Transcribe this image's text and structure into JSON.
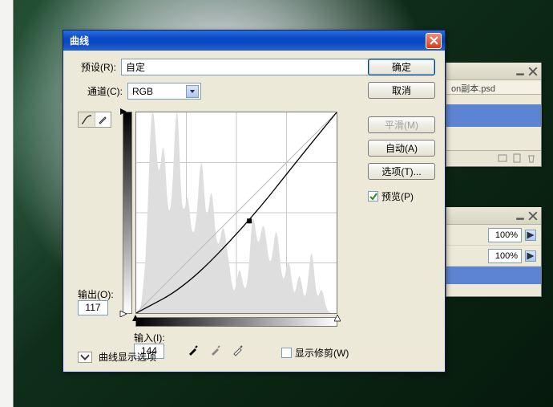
{
  "dialog": {
    "title": "曲线",
    "preset_label": "预设(R):",
    "preset_value": "自定",
    "channel_label": "通道(C):",
    "channel_value": "RGB",
    "output_label": "输出(O):",
    "output_value": "117",
    "input_label": "输入(I):",
    "input_value": "144",
    "show_clipping_label": "显示修剪(W)",
    "expand_label": "曲线显示选项"
  },
  "buttons": {
    "ok": "确定",
    "cancel": "取消",
    "smooth": "平滑(M)",
    "auto": "自动(A)",
    "options": "选项(T)...",
    "preview": "预览(P)"
  },
  "panels": {
    "doc_tab": "on副本.psd",
    "opacity1": "100%",
    "opacity2": "100%"
  },
  "chart_data": {
    "type": "line",
    "title": "",
    "xlabel": "输入",
    "ylabel": "输出",
    "xlim": [
      0,
      255
    ],
    "ylim": [
      0,
      255
    ],
    "series": [
      {
        "name": "baseline",
        "x": [
          0,
          255
        ],
        "y": [
          0,
          255
        ]
      },
      {
        "name": "curve",
        "x": [
          0,
          64,
          144,
          210,
          255
        ],
        "y": [
          0,
          34,
          117,
          200,
          255
        ]
      }
    ],
    "control_point": {
      "input": 144,
      "output": 117
    },
    "histogram": [
      0,
      0,
      1,
      2,
      3,
      5,
      9,
      14,
      22,
      30,
      38,
      48,
      62,
      78,
      96,
      118,
      142,
      165,
      184,
      198,
      206,
      208,
      206,
      200,
      190,
      178,
      166,
      156,
      150,
      148,
      150,
      155,
      162,
      168,
      172,
      170,
      164,
      152,
      138,
      124,
      114,
      108,
      106,
      108,
      112,
      120,
      132,
      148,
      166,
      184,
      198,
      206,
      208,
      202,
      188,
      168,
      146,
      128,
      116,
      110,
      108,
      108,
      110,
      114,
      118,
      120,
      118,
      112,
      104,
      96,
      90,
      86,
      84,
      84,
      86,
      90,
      96,
      104,
      114,
      126,
      138,
      148,
      154,
      156,
      152,
      144,
      132,
      120,
      110,
      104,
      102,
      104,
      108,
      114,
      120,
      124,
      124,
      120,
      112,
      102,
      92,
      84,
      78,
      74,
      72,
      72,
      74,
      78,
      82,
      86,
      88,
      88,
      86,
      82,
      76,
      70,
      64,
      58,
      52,
      46,
      40,
      34,
      30,
      26,
      24,
      24,
      26,
      30,
      34,
      38,
      42,
      44,
      44,
      42,
      38,
      34,
      30,
      28,
      26,
      26,
      28,
      32,
      38,
      46,
      56,
      68,
      80,
      90,
      96,
      98,
      96,
      92,
      86,
      80,
      76,
      74,
      74,
      76,
      80,
      84,
      88,
      90,
      90,
      88,
      84,
      78,
      72,
      66,
      60,
      56,
      54,
      54,
      56,
      60,
      66,
      72,
      78,
      82,
      84,
      82,
      78,
      72,
      64,
      56,
      48,
      42,
      38,
      36,
      36,
      38,
      42,
      46,
      50,
      52,
      52,
      50,
      46,
      40,
      34,
      28,
      24,
      22,
      22,
      24,
      28,
      32,
      36,
      38,
      38,
      36,
      32,
      28,
      24,
      20,
      18,
      18,
      20,
      24,
      30,
      38,
      46,
      54,
      60,
      62,
      60,
      54,
      46,
      38,
      30,
      24,
      20,
      18,
      18,
      20,
      22,
      24,
      24,
      22,
      20,
      16,
      12,
      8,
      6,
      4,
      2,
      2,
      1,
      1,
      0,
      0,
      0,
      0,
      0,
      0,
      0,
      0
    ]
  }
}
